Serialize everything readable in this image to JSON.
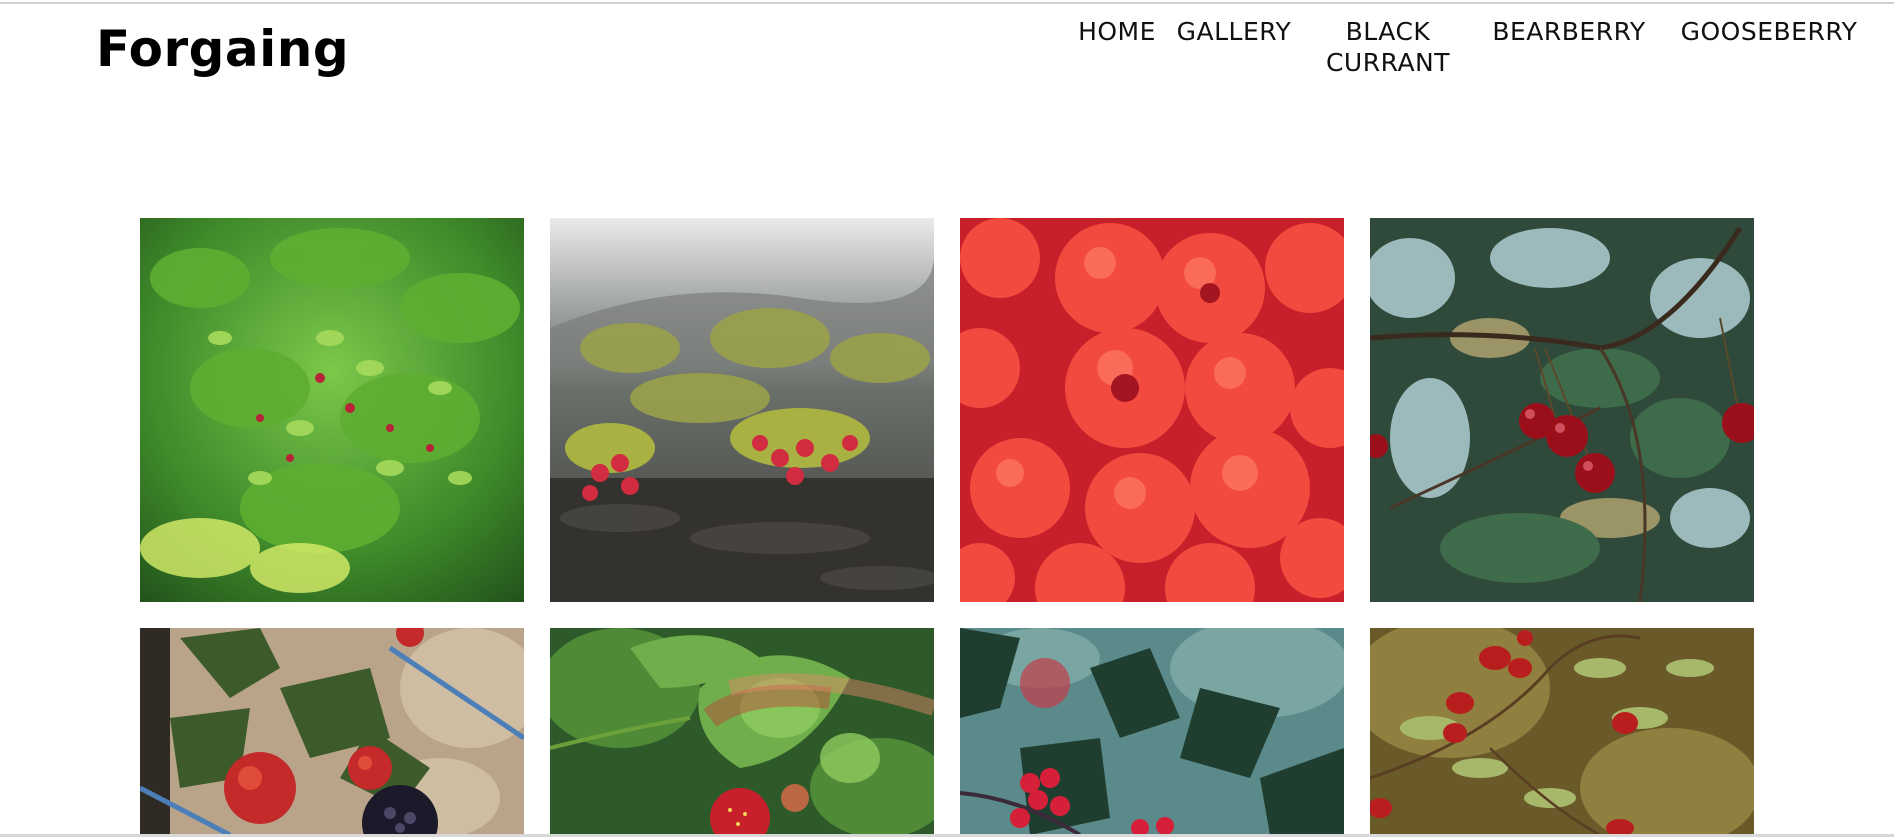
{
  "site": {
    "logo": "Forgaing"
  },
  "nav": {
    "home": "HOME",
    "gallery": "GALLERY",
    "black_currant_line1": "BLACK",
    "black_currant_line2": "CURRANT",
    "bearberry": "BEARBERRY",
    "gooseberry": "GOOSEBERRY"
  },
  "gallery": {
    "tiles": [
      {
        "subject": "blueberry bush"
      },
      {
        "subject": "bearberry shrub"
      },
      {
        "subject": "raspberries"
      },
      {
        "subject": "cherries on branch"
      },
      {
        "subject": "blackberries"
      },
      {
        "subject": "wild strawberry"
      },
      {
        "subject": "holly berries"
      },
      {
        "subject": "rosehip branch"
      }
    ]
  },
  "colors": {
    "background": "#ffffff",
    "text": "#111111"
  }
}
